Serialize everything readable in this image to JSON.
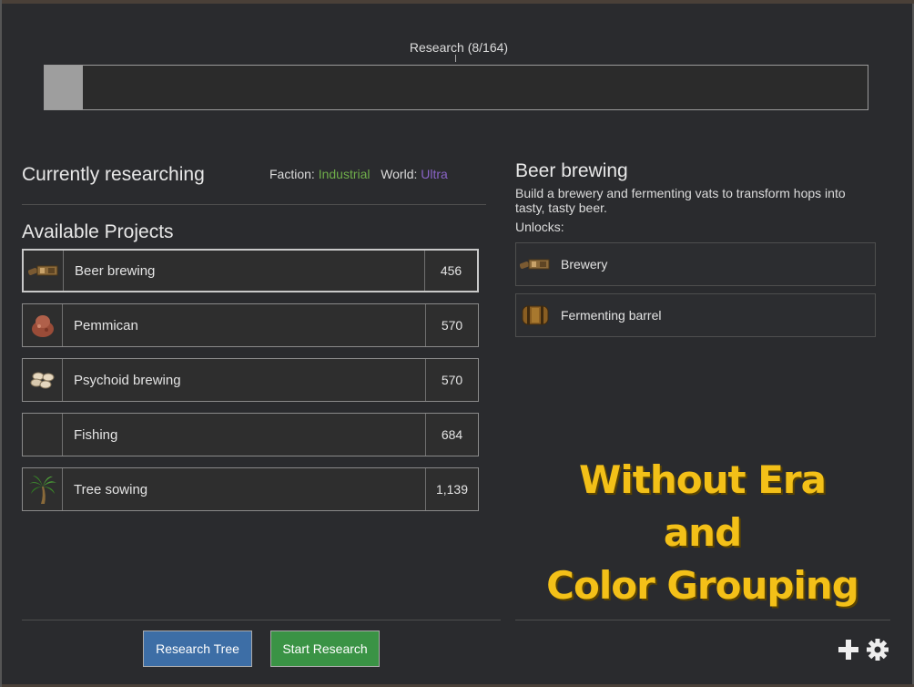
{
  "research_progress": {
    "label": "Research (8/164)",
    "fraction": 0.047
  },
  "left_panel": {
    "current_heading": "Currently researching",
    "faction_label": "Faction:",
    "faction_value": "Industrial",
    "world_label": "World:",
    "world_value": "Ultra",
    "available_heading": "Available Projects",
    "projects": [
      {
        "name": "Beer brewing",
        "cost": "456",
        "icon": "brewery-icon",
        "selected": true
      },
      {
        "name": "Pemmican",
        "cost": "570",
        "icon": "pemmican-icon",
        "selected": false
      },
      {
        "name": "Psychoid brewing",
        "cost": "570",
        "icon": "psychoid-icon",
        "selected": false
      },
      {
        "name": "Fishing",
        "cost": "684",
        "icon": "",
        "selected": false
      },
      {
        "name": "Tree sowing",
        "cost": "1,139",
        "icon": "palm-tree-icon",
        "selected": false
      }
    ]
  },
  "detail": {
    "title": "Beer brewing",
    "description": "Build a brewery and fermenting vats to transform hops into tasty, tasty beer.",
    "unlocks_label": "Unlocks:",
    "unlocks": [
      {
        "name": "Brewery",
        "icon": "brewery-icon"
      },
      {
        "name": "Fermenting barrel",
        "icon": "barrel-icon"
      }
    ]
  },
  "overlay_caption": {
    "line1": "Without Era and",
    "line2": "Color Grouping",
    "color": "#f3c018"
  },
  "buttons": {
    "research_tree": "Research Tree",
    "start_research": "Start Research"
  },
  "colors": {
    "faction": "#6fae4a",
    "world": "#8a64c8",
    "blue_button": "#3d6ea6",
    "green_button": "#3a9345"
  }
}
